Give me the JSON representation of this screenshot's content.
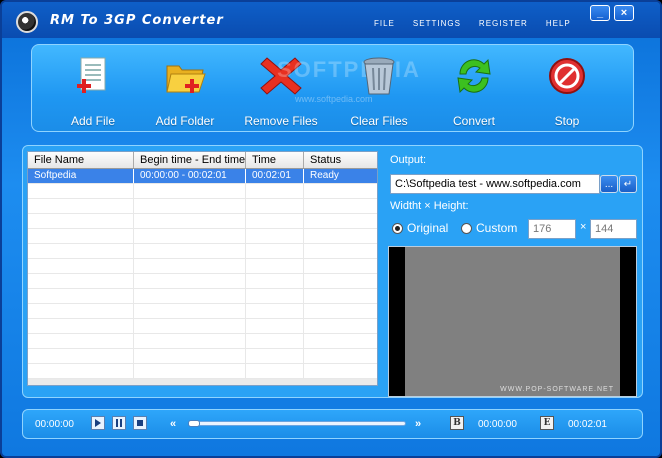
{
  "app": {
    "title": "RM To 3GP Converter"
  },
  "menu": [
    "FILE",
    "SETTINGS",
    "REGISTER",
    "HELP"
  ],
  "window_buttons": {
    "minimize": "_",
    "close": "×"
  },
  "toolbar": {
    "add_file": "Add File",
    "add_folder": "Add Folder",
    "remove_files": "Remove Files",
    "clear_files": "Clear Files",
    "convert": "Convert",
    "stop": "Stop"
  },
  "watermark": {
    "main": "SOFTPEDIA",
    "sub": "www.softpedia.com"
  },
  "table": {
    "headers": [
      "File Name",
      "Begin time - End time",
      "Time",
      "Status"
    ],
    "rows": [
      {
        "name": "Softpedia",
        "range": "00:00:00 - 00:02:01",
        "time": "00:02:01",
        "status": "Ready"
      }
    ]
  },
  "output": {
    "label": "Output:",
    "path": "C:\\Softpedia test - www.softpedia.com",
    "browse_label": "...",
    "open_label": "↵"
  },
  "size": {
    "label": "Widtht × Height:",
    "original_label": "Original",
    "custom_label": "Custom",
    "width": "176",
    "times": "×",
    "height": "144",
    "selected": "original"
  },
  "preview": {
    "watermark": "WWW.POP-SOFTWARE.NET"
  },
  "player": {
    "current_time": "00:00:00",
    "seek_position": 0,
    "rewind": "«",
    "forward": "»",
    "begin_label": "B",
    "begin_time": "00:00:00",
    "end_label": "E",
    "end_time": "00:02:01"
  }
}
